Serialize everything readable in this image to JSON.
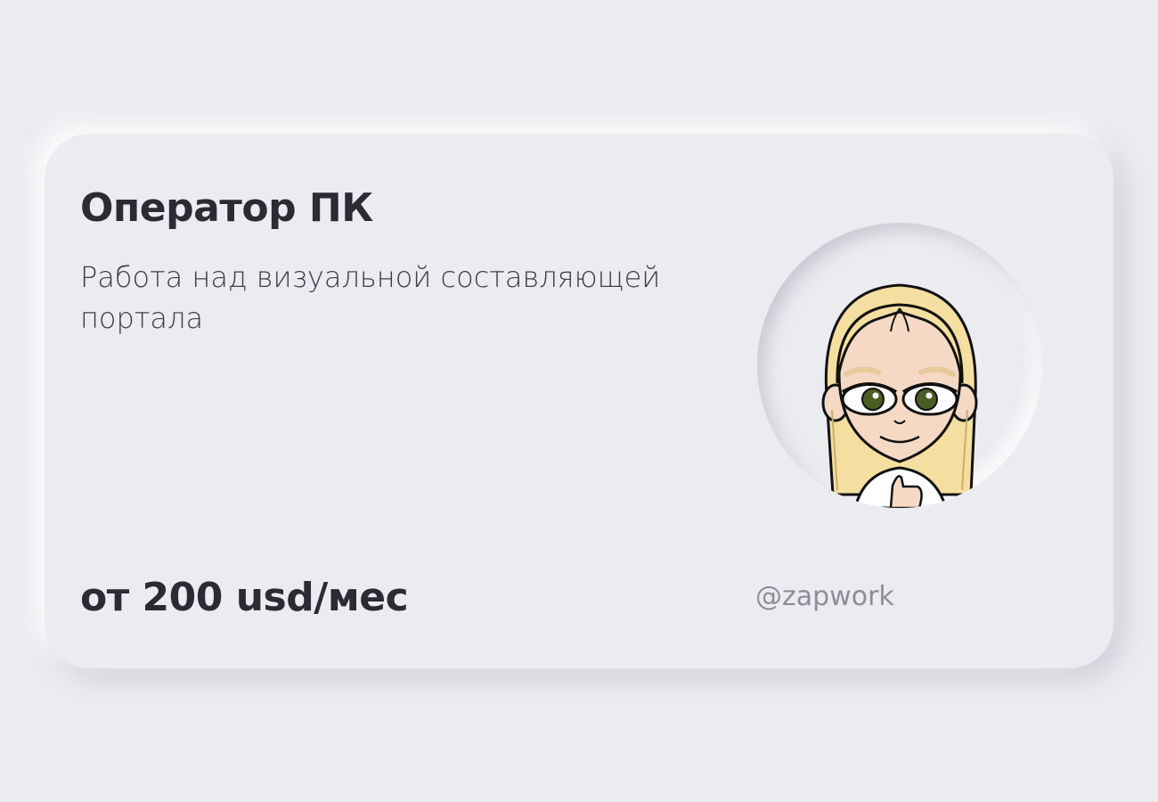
{
  "card": {
    "title": "Оператор ПК",
    "description": "Работа над визуальной составляющей портала",
    "salary": "от 200 usd/мес",
    "handle": "@zapwork"
  },
  "colors": {
    "background": "#ebecf0",
    "text_primary": "#2b2b34",
    "text_muted": "#8c8d99"
  },
  "avatar": {
    "icon": "cartoon-girl-avatar"
  }
}
